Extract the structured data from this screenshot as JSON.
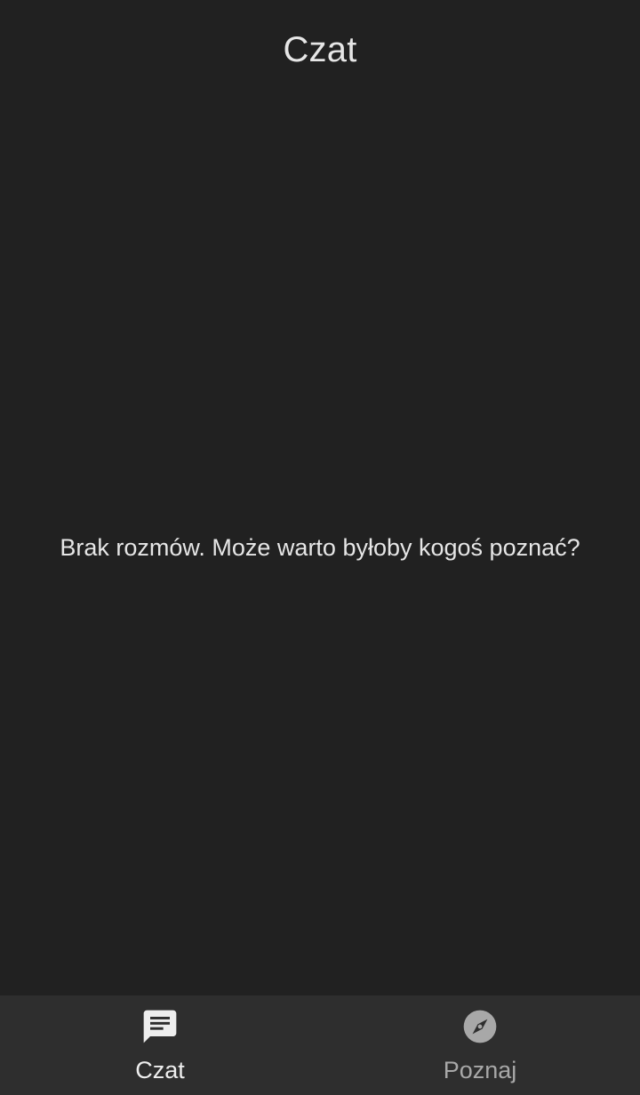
{
  "app_bar": {
    "title": "Czat"
  },
  "content": {
    "empty_message": "Brak rozmów. Może warto byłoby kogoś poznać?"
  },
  "bottom_nav": {
    "items": [
      {
        "label": "Czat",
        "icon": "chat-icon",
        "active": true
      },
      {
        "label": "Poznaj",
        "icon": "compass-icon",
        "active": false
      }
    ]
  },
  "colors": {
    "background": "#212121",
    "nav_background": "#2e2e2e",
    "active": "#eeeeee",
    "inactive": "#a8a8a8"
  }
}
